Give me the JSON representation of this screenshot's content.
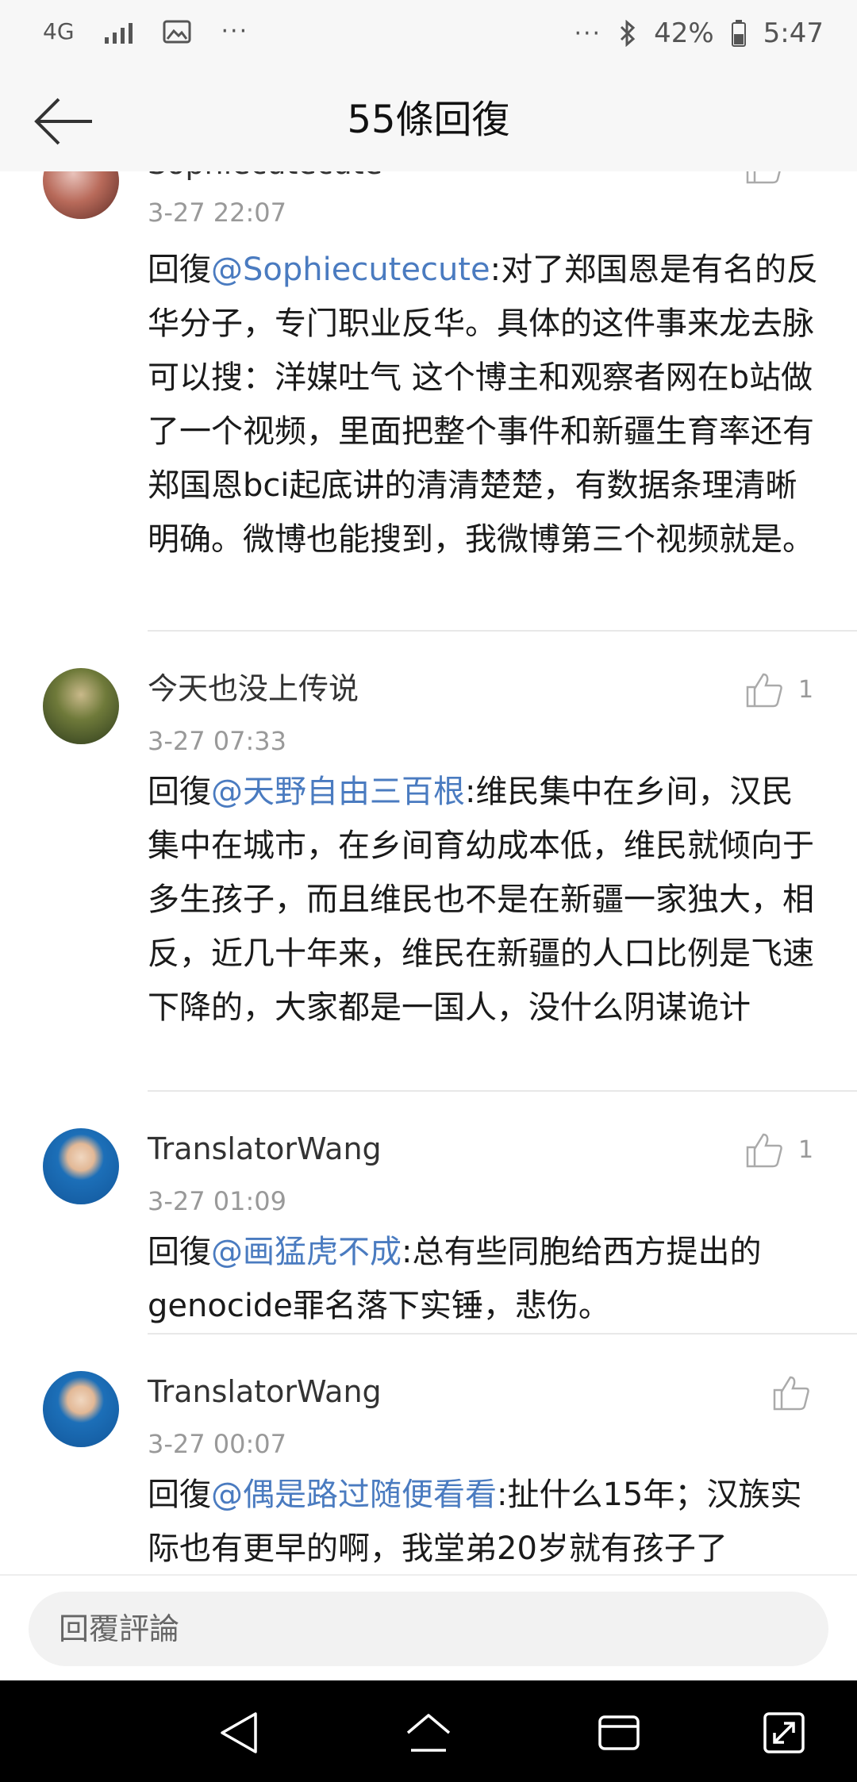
{
  "status_bar": {
    "network": "4G",
    "dots_left": "···",
    "dots_right": "···",
    "battery_percent": "42%",
    "time": "5:47",
    "icons": [
      "signal-icon",
      "image-icon",
      "bluetooth-icon",
      "battery-icon"
    ]
  },
  "header": {
    "title": "55條回復",
    "back_icon": "arrow-left-icon"
  },
  "comments": [
    {
      "username": "Sophiecutecute",
      "time": "3-27 22:07",
      "prefix": "回復",
      "mention": "@Sophiecutecute",
      "text": ":对了郑国恩是有名的反华分子，专门职业反华。具体的这件事来龙去脉可以搜：洋媒吐气 这个博主和观察者网在b站做了一个视频，里面把整个事件和新疆生育率还有郑国恩bci起底讲的清清楚楚，有数据条理清晰明确。微博也能搜到，我微博第三个视频就是。",
      "likes": ""
    },
    {
      "username": "今天也没上传说",
      "time": "3-27 07:33",
      "prefix": "回復",
      "mention": "@天野自由三百根",
      "text": ":维民集中在乡间，汉民集中在城市，在乡间育幼成本低，维民就倾向于多生孩子，而且维民也不是在新疆一家独大，相反，近几十年来，维民在新疆的人口比例是飞速下降的，大家都是一国人，没什么阴谋诡计",
      "likes": "1"
    },
    {
      "username": "TranslatorWang",
      "time": "3-27 01:09",
      "prefix": "回復",
      "mention": "@画猛虎不成",
      "text": ":总有些同胞给西方提出的genocide罪名落下实锤，悲伤。",
      "likes": "1"
    },
    {
      "username": "TranslatorWang",
      "time": "3-27 00:07",
      "prefix": "回復",
      "mention": "@偶是路过随便看看",
      "text": ":扯什么15年；汉族实际也有更早的啊，我堂弟20岁就有孩子了",
      "likes": ""
    }
  ],
  "reply_bar": {
    "placeholder": "回覆評論"
  },
  "nav_bar": {
    "icons": [
      "back-triangle-icon",
      "home-icon",
      "recents-icon",
      "expand-icon"
    ]
  },
  "colors": {
    "mention": "#4a7bc0",
    "header_bg": "#f7f7f7",
    "nav_bg": "#000000"
  }
}
